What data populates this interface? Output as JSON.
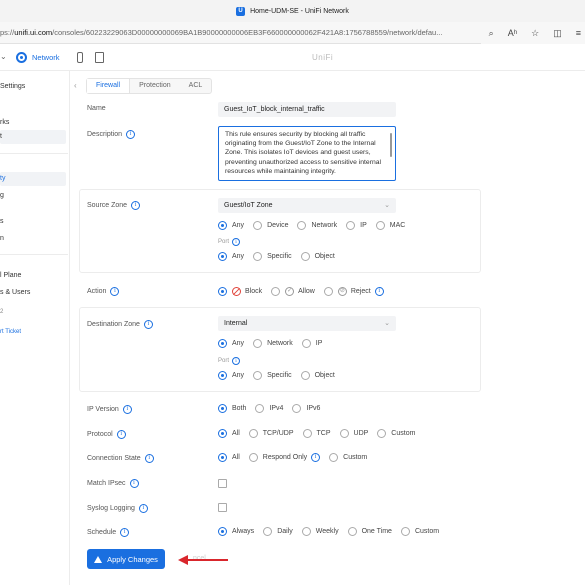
{
  "browser": {
    "title": "Home-UDM-SE - UniFi Network",
    "url_prefix": "ps://",
    "url_host": "unifi.ui.com",
    "url_rest": "/consoles/60223229063D00000000069BA1B90000000006EB3F660000000062F421A8:1756788559/network/defau...",
    "favicon_letter": "U"
  },
  "app": {
    "network_label": "Network",
    "brand": "UniFi"
  },
  "sidebar": {
    "items": [
      "Settings",
      "rks",
      "t",
      "ty",
      "g",
      "s",
      "n",
      "l Plane",
      "s & Users",
      "2",
      "rt Ticket"
    ]
  },
  "tabs": [
    "Firewall",
    "Protection",
    "ACL"
  ],
  "form": {
    "name_label": "Name",
    "name_value": "Guest_IoT_block_internal_traffic",
    "description_label": "Description",
    "description_value": "This rule ensures security by blocking all traffic originating from the Guest/IoT Zone to the Internal Zone. This isolates IoT devices and guest users, preventing unauthorized access to sensitive internal resources while maintaining integrity.",
    "source_zone_label": "Source Zone",
    "source_zone_value": "Guest/IoT Zone",
    "source_options": [
      "Any",
      "Device",
      "Network",
      "IP",
      "MAC"
    ],
    "port_label": "Port",
    "source_port_options": [
      "Any",
      "Specific",
      "Object"
    ],
    "action_label": "Action",
    "action_options": [
      "Block",
      "Allow",
      "Reject"
    ],
    "destination_zone_label": "Destination Zone",
    "destination_zone_value": "Internal",
    "destination_options": [
      "Any",
      "Network",
      "IP"
    ],
    "destination_port_options": [
      "Any",
      "Specific",
      "Object"
    ],
    "ip_version_label": "IP Version",
    "ip_version_options": [
      "Both",
      "IPv4",
      "IPv6"
    ],
    "protocol_label": "Protocol",
    "protocol_options": [
      "All",
      "TCP/UDP",
      "TCP",
      "UDP",
      "Custom"
    ],
    "connection_state_label": "Connection State",
    "connection_state_options": [
      "All",
      "Respond Only",
      "Custom"
    ],
    "match_ipsec_label": "Match IPsec",
    "syslog_label": "Syslog Logging",
    "schedule_label": "Schedule",
    "schedule_options": [
      "Always",
      "Daily",
      "Weekly",
      "One Time",
      "Custom"
    ],
    "apply_label": "Apply Changes",
    "behind_text": "ncel"
  },
  "colors": {
    "accent": "#1a6fe0",
    "block": "#e0443b",
    "arrow": "#d9262c"
  }
}
